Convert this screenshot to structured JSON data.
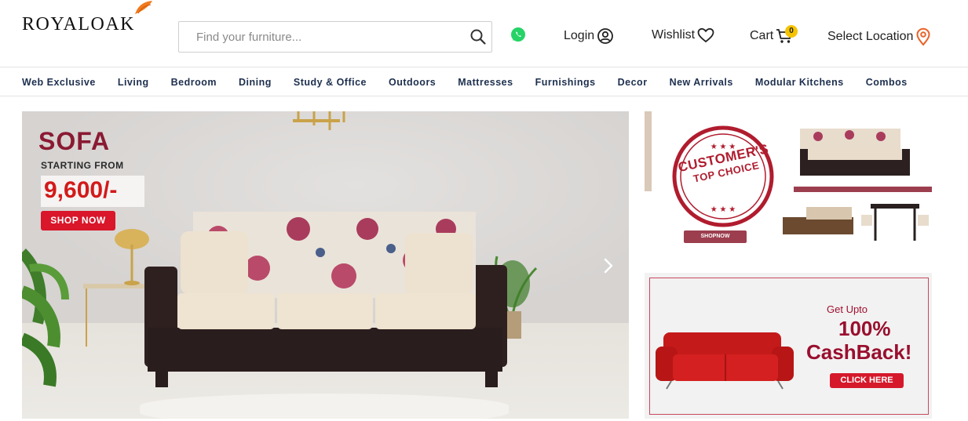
{
  "brand": {
    "logo_text": "ROYALOAK"
  },
  "header": {
    "search_placeholder": "Find your furniture...",
    "login_label": "Login",
    "wishlist_label": "Wishlist",
    "cart_label": "Cart",
    "cart_count": "0",
    "location_label": "Select Location"
  },
  "nav": {
    "items": [
      {
        "label": "Web Exclusive"
      },
      {
        "label": "Living"
      },
      {
        "label": "Bedroom"
      },
      {
        "label": "Dining"
      },
      {
        "label": "Study & Office"
      },
      {
        "label": "Outdoors"
      },
      {
        "label": "Mattresses"
      },
      {
        "label": "Furnishings"
      },
      {
        "label": "Decor"
      },
      {
        "label": "New Arrivals"
      },
      {
        "label": "Modular Kitchens"
      },
      {
        "label": "Combos"
      }
    ]
  },
  "hero": {
    "title": "SOFA",
    "subtitle": "STARTING FROM",
    "price": "9,600/-",
    "cta": "SHOP NOW"
  },
  "promo_top": {
    "badge_line1": "CUSTOMER'S",
    "badge_line2": "TOP CHOICE",
    "cta": "SHOPNOW"
  },
  "promo_bottom": {
    "line1": "Get Upto",
    "line2": "100%",
    "line3": "CashBack!",
    "cta": "CLICK HERE"
  },
  "colors": {
    "nav_text": "#1d2f4e",
    "hero_title": "#8a1a33",
    "price": "#d21a1a",
    "cta_red": "#d9162a",
    "cart_badge": "#f5c400",
    "whatsapp": "#25d366",
    "location_pin": "#e8632a"
  }
}
